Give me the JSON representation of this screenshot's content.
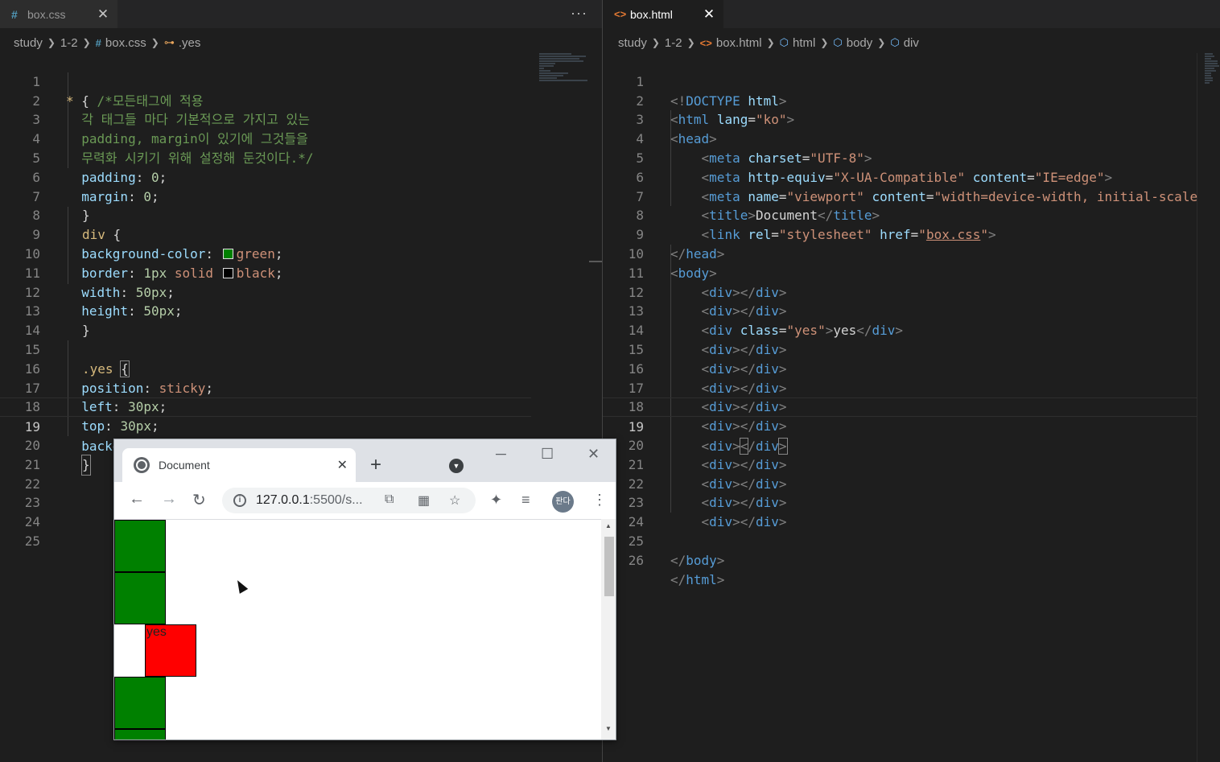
{
  "left": {
    "tab": {
      "icon": "#",
      "label": "box.css",
      "close": "✕"
    },
    "more": "···",
    "breadcrumb": {
      "a": "study",
      "b": "1-2",
      "c": "box.css",
      "d": ".yes"
    },
    "lines": [
      {
        "n": "1"
      },
      {
        "n": "2"
      },
      {
        "n": "3"
      },
      {
        "n": "4"
      },
      {
        "n": "5"
      },
      {
        "n": "6"
      },
      {
        "n": "7"
      },
      {
        "n": "8"
      },
      {
        "n": "9"
      },
      {
        "n": "10"
      },
      {
        "n": "11"
      },
      {
        "n": "12"
      },
      {
        "n": "13"
      },
      {
        "n": "14"
      },
      {
        "n": "15"
      },
      {
        "n": "16"
      },
      {
        "n": "17"
      },
      {
        "n": "18"
      },
      {
        "n": "19"
      },
      {
        "n": "20"
      },
      {
        "n": "21"
      },
      {
        "n": "22"
      },
      {
        "n": "23"
      },
      {
        "n": "24"
      },
      {
        "n": "25"
      }
    ],
    "code": {
      "l1_sel": "*",
      "l1_brace": " { ",
      "l1_comment": "/*모든태그에 적용",
      "l2": "  각 태그들 마다 기본적으로 가지고 있는",
      "l3": "  padding, margin이 있기에 그것들을",
      "l4": "  무력화 시키기 위해 설정해 둔것이다.*/",
      "l5_prop": "padding",
      "l5_val": "0",
      "l6_prop": "margin",
      "l6_val": "0",
      "l7": "}",
      "l8_sel": "div",
      "l8_brace": " {",
      "l9_prop": "background-color",
      "l9_val": "green",
      "l10_prop": "border",
      "l10_num": "1px",
      "l10_kw": "solid",
      "l10_val": "black",
      "l11_prop": "width",
      "l11_val": "50px",
      "l12_prop": "height",
      "l12_val": "50px",
      "l13": "}",
      "l15_sel": ".yes",
      "l15_brace": "{",
      "l16_prop": "position",
      "l16_val": "sticky",
      "l17_prop": "left",
      "l17_val": "30px",
      "l18_prop": "top",
      "l18_val": "30px",
      "l19_prop": "background-color",
      "l19_val": "red",
      "l20": "}"
    }
  },
  "right": {
    "tab": {
      "icon": "<>",
      "label": "box.html",
      "close": "✕"
    },
    "breadcrumb": {
      "a": "study",
      "b": "1-2",
      "c": "box.html",
      "d": "html",
      "e": "body",
      "f": "div"
    },
    "lines": [
      {
        "n": "1"
      },
      {
        "n": "2"
      },
      {
        "n": "3"
      },
      {
        "n": "4"
      },
      {
        "n": "5"
      },
      {
        "n": "6"
      },
      {
        "n": "7"
      },
      {
        "n": "8"
      },
      {
        "n": "9"
      },
      {
        "n": "10"
      },
      {
        "n": "11"
      },
      {
        "n": "12"
      },
      {
        "n": "13"
      },
      {
        "n": "14"
      },
      {
        "n": "15"
      },
      {
        "n": "16"
      },
      {
        "n": "17"
      },
      {
        "n": "18"
      },
      {
        "n": "19"
      },
      {
        "n": "20"
      },
      {
        "n": "21"
      },
      {
        "n": "22"
      },
      {
        "n": "23"
      },
      {
        "n": "24"
      },
      {
        "n": "25"
      },
      {
        "n": "26"
      }
    ],
    "code": {
      "doctype": "DOCTYPE",
      "html": "html",
      "lang_attr": "lang",
      "lang_val": "\"ko\"",
      "head": "head",
      "meta": "meta",
      "charset_attr": "charset",
      "charset_val": "\"UTF-8\"",
      "http_attr": "http-equiv",
      "http_val": "\"X-UA-Compatible\"",
      "content_attr": "content",
      "content_val": "\"IE=edge\"",
      "name_attr": "name",
      "name_val": "\"viewport\"",
      "content2_val": "\"width=device-width, initial-scale",
      "title": "title",
      "title_text": "Document",
      "link": "link",
      "rel_attr": "rel",
      "rel_val": "\"stylesheet\"",
      "href_attr": "href",
      "href_val": "box.css",
      "body": "body",
      "div": "div",
      "class_attr": "class",
      "class_val": "\"yes\"",
      "yes_text": "yes"
    }
  },
  "browser": {
    "tab_title": "Document",
    "tab_close": "✕",
    "new_tab": "+",
    "url_host": "127.0.0.1",
    "url_rest": ":5500/s...",
    "profile": "판다",
    "yes_label": "yes",
    "colors": {
      "green": "#008000",
      "red": "#ff0000"
    }
  },
  "colors": {
    "editor_bg": "#1e1e1e",
    "accent_orange": "#e37933",
    "accent_blue": "#519aba"
  }
}
